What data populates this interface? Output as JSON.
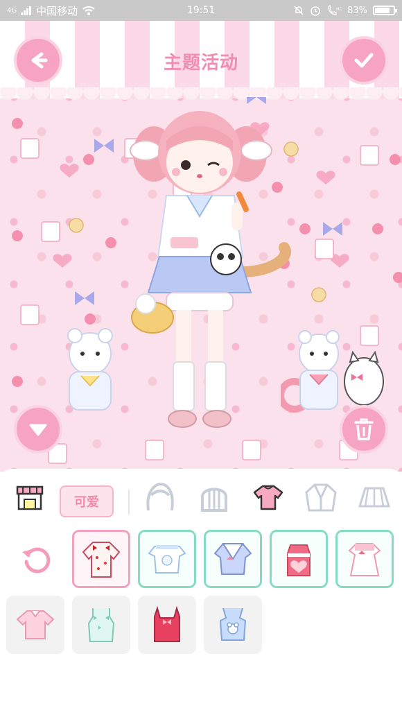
{
  "status_bar": {
    "signal": "4G",
    "carrier": "中国移动",
    "time": "19:51",
    "battery": "83%",
    "battery_level": 0.83
  },
  "header": {
    "title": "主题活动",
    "back_icon": "arrow-left-icon",
    "confirm_icon": "checkmark-icon"
  },
  "stage": {
    "down_icon": "triangle-down-icon",
    "delete_icon": "trash-icon"
  },
  "categories": {
    "shop_icon": "shop-icon",
    "tag_label": "可爱",
    "items": [
      "hair-front-icon",
      "hair-back-icon",
      "top-icon",
      "jacket-icon",
      "skirt-icon"
    ],
    "selected": "top-icon"
  },
  "clothing": {
    "reset_icon": "refresh-icon",
    "items": [
      {
        "name": "red-blouse",
        "style": "selected"
      },
      {
        "name": "bunny-top",
        "style": "mint"
      },
      {
        "name": "sailor-top",
        "style": "mint"
      },
      {
        "name": "pink-heart-top",
        "style": "mint"
      },
      {
        "name": "white-dress-top",
        "style": "mint"
      },
      {
        "name": "pink-tshirt",
        "style": "plain"
      },
      {
        "name": "mint-camisole",
        "style": "plain"
      },
      {
        "name": "red-tank",
        "style": "plain"
      },
      {
        "name": "blue-bear-top",
        "style": "plain"
      }
    ]
  },
  "colors": {
    "accent": "#f6a4c2",
    "mint": "#86dcc2",
    "title_pink": "#f08db0"
  }
}
